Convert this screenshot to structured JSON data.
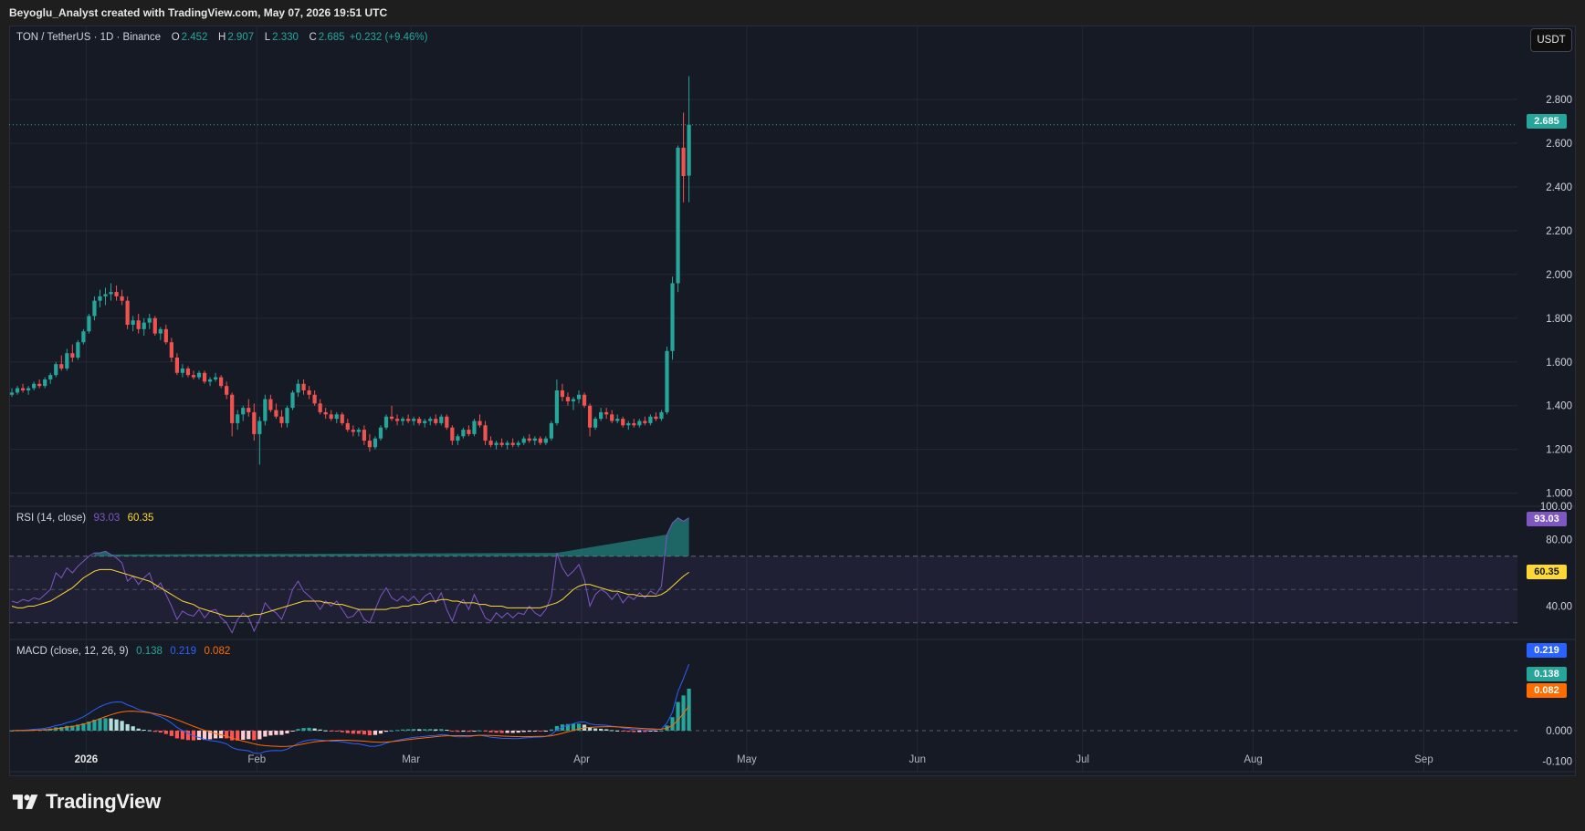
{
  "attribution": "Beyoglu_Analyst created with TradingView.com, May 07, 2026 19:51 UTC",
  "brand": "TradingView",
  "currency_button": "USDT",
  "colors": {
    "up": "#26a69a",
    "down": "#ef5350",
    "rsi": "#7e57c2",
    "rsi_ma": "#fdd835",
    "macd": "#2962ff",
    "signal": "#ff6d00",
    "background": "#161a25"
  },
  "legend": {
    "symbol": "TON / TetherUS · 1D · Binance",
    "o_label": "O",
    "o": "2.452",
    "h_label": "H",
    "h": "2.907",
    "l_label": "L",
    "l": "2.330",
    "c_label": "C",
    "c": "2.685",
    "change": "+0.232 (+9.46%)"
  },
  "rsi_legend": {
    "title": "RSI (14, close)",
    "rsi": "93.03",
    "ma": "60.35"
  },
  "macd_legend": {
    "title": "MACD (close, 12, 26, 9)",
    "hist": "0.138",
    "macd": "0.219",
    "signal": "0.082"
  },
  "chart_data": {
    "type": "candlestick",
    "symbol": "TON / TetherUS",
    "interval": "1D",
    "exchange": "Binance",
    "price_axis": {
      "ticks": [
        "2.800",
        "2.600",
        "2.400",
        "2.200",
        "2.000",
        "1.800",
        "1.600",
        "1.400",
        "1.200",
        "1.000"
      ],
      "range": [
        0.94,
        3.03
      ],
      "last_price": "2.685"
    },
    "time_axis": {
      "labels": [
        "2026",
        "Feb",
        "Mar",
        "Apr",
        "May",
        "Jun",
        "Jul",
        "Aug",
        "Sep"
      ],
      "start": "2025-12-18",
      "end": "2026-09-18"
    },
    "candles_start": "2025-12-18",
    "candles": [
      [
        1.45,
        1.48,
        1.44,
        1.46
      ],
      [
        1.46,
        1.49,
        1.45,
        1.48
      ],
      [
        1.48,
        1.5,
        1.46,
        1.47
      ],
      [
        1.47,
        1.49,
        1.45,
        1.48
      ],
      [
        1.48,
        1.51,
        1.47,
        1.5
      ],
      [
        1.5,
        1.52,
        1.48,
        1.49
      ],
      [
        1.49,
        1.53,
        1.48,
        1.52
      ],
      [
        1.52,
        1.55,
        1.5,
        1.54
      ],
      [
        1.54,
        1.6,
        1.53,
        1.59
      ],
      [
        1.59,
        1.63,
        1.56,
        1.57
      ],
      [
        1.57,
        1.66,
        1.56,
        1.64
      ],
      [
        1.64,
        1.68,
        1.6,
        1.62
      ],
      [
        1.62,
        1.7,
        1.61,
        1.69
      ],
      [
        1.69,
        1.75,
        1.68,
        1.74
      ],
      [
        1.74,
        1.82,
        1.73,
        1.81
      ],
      [
        1.81,
        1.9,
        1.79,
        1.88
      ],
      [
        1.88,
        1.93,
        1.85,
        1.9
      ],
      [
        1.9,
        1.94,
        1.86,
        1.91
      ],
      [
        1.91,
        1.96,
        1.88,
        1.92
      ],
      [
        1.92,
        1.95,
        1.88,
        1.9
      ],
      [
        1.9,
        1.93,
        1.86,
        1.88
      ],
      [
        1.88,
        1.9,
        1.75,
        1.77
      ],
      [
        1.77,
        1.81,
        1.74,
        1.79
      ],
      [
        1.79,
        1.82,
        1.73,
        1.75
      ],
      [
        1.75,
        1.8,
        1.72,
        1.78
      ],
      [
        1.78,
        1.82,
        1.75,
        1.8
      ],
      [
        1.8,
        1.81,
        1.72,
        1.73
      ],
      [
        1.73,
        1.76,
        1.7,
        1.75
      ],
      [
        1.75,
        1.77,
        1.68,
        1.69
      ],
      [
        1.69,
        1.71,
        1.6,
        1.62
      ],
      [
        1.62,
        1.64,
        1.54,
        1.55
      ],
      [
        1.55,
        1.59,
        1.53,
        1.57
      ],
      [
        1.57,
        1.58,
        1.53,
        1.54
      ],
      [
        1.54,
        1.56,
        1.52,
        1.53
      ],
      [
        1.53,
        1.56,
        1.52,
        1.55
      ],
      [
        1.55,
        1.56,
        1.5,
        1.51
      ],
      [
        1.51,
        1.53,
        1.49,
        1.52
      ],
      [
        1.52,
        1.55,
        1.51,
        1.53
      ],
      [
        1.53,
        1.54,
        1.48,
        1.49
      ],
      [
        1.49,
        1.51,
        1.43,
        1.45
      ],
      [
        1.45,
        1.46,
        1.26,
        1.32
      ],
      [
        1.32,
        1.38,
        1.29,
        1.36
      ],
      [
        1.36,
        1.4,
        1.33,
        1.39
      ],
      [
        1.39,
        1.43,
        1.35,
        1.37
      ],
      [
        1.37,
        1.41,
        1.24,
        1.27
      ],
      [
        1.27,
        1.35,
        1.13,
        1.33
      ],
      [
        1.33,
        1.45,
        1.31,
        1.43
      ],
      [
        1.43,
        1.45,
        1.37,
        1.38
      ],
      [
        1.38,
        1.41,
        1.34,
        1.35
      ],
      [
        1.35,
        1.38,
        1.3,
        1.32
      ],
      [
        1.32,
        1.4,
        1.3,
        1.39
      ],
      [
        1.39,
        1.47,
        1.38,
        1.46
      ],
      [
        1.46,
        1.52,
        1.44,
        1.5
      ],
      [
        1.5,
        1.52,
        1.45,
        1.47
      ],
      [
        1.47,
        1.49,
        1.43,
        1.45
      ],
      [
        1.45,
        1.47,
        1.4,
        1.41
      ],
      [
        1.41,
        1.43,
        1.36,
        1.37
      ],
      [
        1.37,
        1.39,
        1.34,
        1.36
      ],
      [
        1.36,
        1.38,
        1.33,
        1.34
      ],
      [
        1.34,
        1.37,
        1.32,
        1.36
      ],
      [
        1.36,
        1.37,
        1.31,
        1.32
      ],
      [
        1.32,
        1.34,
        1.28,
        1.29
      ],
      [
        1.29,
        1.31,
        1.26,
        1.28
      ],
      [
        1.28,
        1.3,
        1.26,
        1.29
      ],
      [
        1.29,
        1.31,
        1.22,
        1.24
      ],
      [
        1.24,
        1.27,
        1.19,
        1.21
      ],
      [
        1.21,
        1.26,
        1.2,
        1.25
      ],
      [
        1.25,
        1.31,
        1.24,
        1.3
      ],
      [
        1.3,
        1.36,
        1.29,
        1.35
      ],
      [
        1.35,
        1.4,
        1.33,
        1.34
      ],
      [
        1.34,
        1.36,
        1.31,
        1.33
      ],
      [
        1.33,
        1.35,
        1.31,
        1.34
      ],
      [
        1.34,
        1.36,
        1.32,
        1.33
      ],
      [
        1.33,
        1.35,
        1.31,
        1.34
      ],
      [
        1.34,
        1.35,
        1.31,
        1.32
      ],
      [
        1.32,
        1.34,
        1.3,
        1.33
      ],
      [
        1.33,
        1.35,
        1.31,
        1.34
      ],
      [
        1.34,
        1.36,
        1.31,
        1.32
      ],
      [
        1.32,
        1.36,
        1.31,
        1.35
      ],
      [
        1.35,
        1.36,
        1.29,
        1.3
      ],
      [
        1.3,
        1.31,
        1.22,
        1.24
      ],
      [
        1.24,
        1.27,
        1.22,
        1.26
      ],
      [
        1.26,
        1.3,
        1.25,
        1.29
      ],
      [
        1.29,
        1.31,
        1.26,
        1.27
      ],
      [
        1.27,
        1.34,
        1.26,
        1.33
      ],
      [
        1.33,
        1.36,
        1.3,
        1.31
      ],
      [
        1.31,
        1.33,
        1.22,
        1.24
      ],
      [
        1.24,
        1.26,
        1.21,
        1.22
      ],
      [
        1.22,
        1.24,
        1.2,
        1.23
      ],
      [
        1.23,
        1.25,
        1.21,
        1.22
      ],
      [
        1.22,
        1.24,
        1.2,
        1.23
      ],
      [
        1.23,
        1.25,
        1.21,
        1.22
      ],
      [
        1.22,
        1.24,
        1.21,
        1.23
      ],
      [
        1.23,
        1.26,
        1.22,
        1.25
      ],
      [
        1.25,
        1.27,
        1.23,
        1.24
      ],
      [
        1.24,
        1.26,
        1.22,
        1.25
      ],
      [
        1.25,
        1.26,
        1.22,
        1.23
      ],
      [
        1.23,
        1.26,
        1.22,
        1.25
      ],
      [
        1.25,
        1.33,
        1.24,
        1.32
      ],
      [
        1.32,
        1.52,
        1.31,
        1.47
      ],
      [
        1.47,
        1.5,
        1.42,
        1.44
      ],
      [
        1.44,
        1.46,
        1.4,
        1.42
      ],
      [
        1.42,
        1.44,
        1.38,
        1.43
      ],
      [
        1.43,
        1.47,
        1.41,
        1.45
      ],
      [
        1.45,
        1.46,
        1.39,
        1.4
      ],
      [
        1.4,
        1.41,
        1.26,
        1.3
      ],
      [
        1.3,
        1.35,
        1.29,
        1.34
      ],
      [
        1.34,
        1.39,
        1.33,
        1.37
      ],
      [
        1.37,
        1.39,
        1.34,
        1.36
      ],
      [
        1.36,
        1.38,
        1.32,
        1.33
      ],
      [
        1.33,
        1.36,
        1.32,
        1.34
      ],
      [
        1.34,
        1.35,
        1.3,
        1.31
      ],
      [
        1.31,
        1.33,
        1.29,
        1.32
      ],
      [
        1.32,
        1.34,
        1.3,
        1.31
      ],
      [
        1.31,
        1.34,
        1.3,
        1.33
      ],
      [
        1.33,
        1.35,
        1.31,
        1.32
      ],
      [
        1.32,
        1.36,
        1.31,
        1.35
      ],
      [
        1.35,
        1.37,
        1.33,
        1.34
      ],
      [
        1.34,
        1.38,
        1.33,
        1.37
      ],
      [
        1.37,
        1.67,
        1.36,
        1.65
      ],
      [
        1.65,
        1.99,
        1.61,
        1.96
      ],
      [
        1.96,
        2.59,
        1.92,
        2.58
      ],
      [
        2.58,
        2.74,
        2.33,
        2.45
      ],
      [
        2.452,
        2.907,
        2.33,
        2.685
      ]
    ],
    "rsi": {
      "axis_ticks": [
        "100.00",
        "80.00",
        "40.00"
      ],
      "range": [
        20,
        100
      ],
      "bands": [
        70,
        50,
        30
      ],
      "values": [
        43,
        42,
        44,
        43,
        45,
        44,
        47,
        50,
        60,
        57,
        63,
        60,
        64,
        67,
        70,
        72,
        72,
        73,
        71,
        69,
        66,
        55,
        58,
        53,
        57,
        60,
        50,
        54,
        47,
        40,
        32,
        37,
        35,
        34,
        38,
        33,
        37,
        38,
        33,
        30,
        24,
        32,
        36,
        33,
        25,
        32,
        42,
        38,
        36,
        32,
        40,
        50,
        55,
        49,
        46,
        43,
        38,
        43,
        40,
        43,
        38,
        33,
        34,
        38,
        32,
        30,
        38,
        46,
        51,
        45,
        43,
        46,
        43,
        46,
        42,
        46,
        48,
        42,
        48,
        38,
        31,
        40,
        44,
        38,
        47,
        40,
        33,
        31,
        36,
        33,
        36,
        33,
        36,
        35,
        40,
        36,
        34,
        38,
        46,
        72,
        63,
        58,
        61,
        65,
        56,
        40,
        47,
        50,
        48,
        44,
        48,
        42,
        46,
        44,
        48,
        45,
        49,
        47,
        52,
        83,
        90,
        93,
        91,
        93.03
      ],
      "ma_values": [
        40,
        39,
        39,
        40,
        40,
        41,
        42,
        43,
        45,
        47,
        49,
        51,
        54,
        57,
        59,
        61,
        62,
        62,
        62,
        61,
        60,
        59,
        58,
        57,
        56,
        55,
        53,
        51,
        49,
        47,
        45,
        43,
        42,
        41,
        39,
        38,
        37,
        36,
        35,
        34,
        34,
        34,
        34,
        34,
        35,
        35,
        36,
        37,
        38,
        39,
        40,
        41,
        42,
        43,
        43,
        43,
        43,
        42,
        42,
        41,
        41,
        40,
        39,
        38,
        38,
        38,
        38,
        38,
        38,
        39,
        39,
        40,
        40,
        41,
        41,
        42,
        43,
        43,
        44,
        44,
        43,
        43,
        42,
        42,
        42,
        41,
        41,
        40,
        40,
        40,
        39,
        39,
        39,
        39,
        39,
        39,
        39,
        40,
        41,
        42,
        44,
        47,
        50,
        52,
        53,
        53,
        52,
        51,
        50,
        49,
        49,
        48,
        47,
        47,
        46,
        46,
        46,
        46,
        47,
        49,
        52,
        55,
        58,
        60.35
      ]
    },
    "macd": {
      "axis_ticks": [
        "0.000",
        "-0.100"
      ],
      "range": [
        -0.135,
        0.3
      ],
      "hist_last": 0.138,
      "macd_last": 0.219,
      "signal_last": 0.082
    }
  }
}
